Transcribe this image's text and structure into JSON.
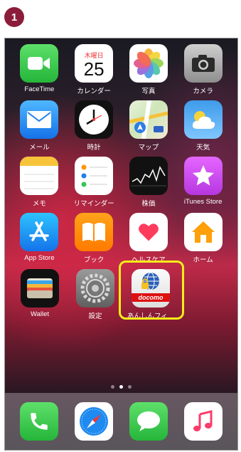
{
  "step_number": "1",
  "calendar": {
    "weekday": "木曜日",
    "day": "25"
  },
  "docomo_brand": "docomo",
  "rows": [
    [
      "FaceTime",
      "カレンダー",
      "写真",
      "カメラ"
    ],
    [
      "メール",
      "時計",
      "マップ",
      "天気"
    ],
    [
      "メモ",
      "リマインダー",
      "株価",
      "iTunes Store"
    ],
    [
      "App Store",
      "ブック",
      "ヘルスケア",
      "ホーム"
    ],
    [
      "Wallet",
      "設定",
      "あんしんフィ…"
    ]
  ],
  "dock": [
    "電話",
    "Safari",
    "メッセージ",
    "ミュージック"
  ],
  "page_indicator": {
    "count": 3,
    "active": 2
  },
  "colors": {
    "badge": "#8b1d3b",
    "highlight": "#f5ee1a",
    "docomo_red": "#dd1111"
  }
}
